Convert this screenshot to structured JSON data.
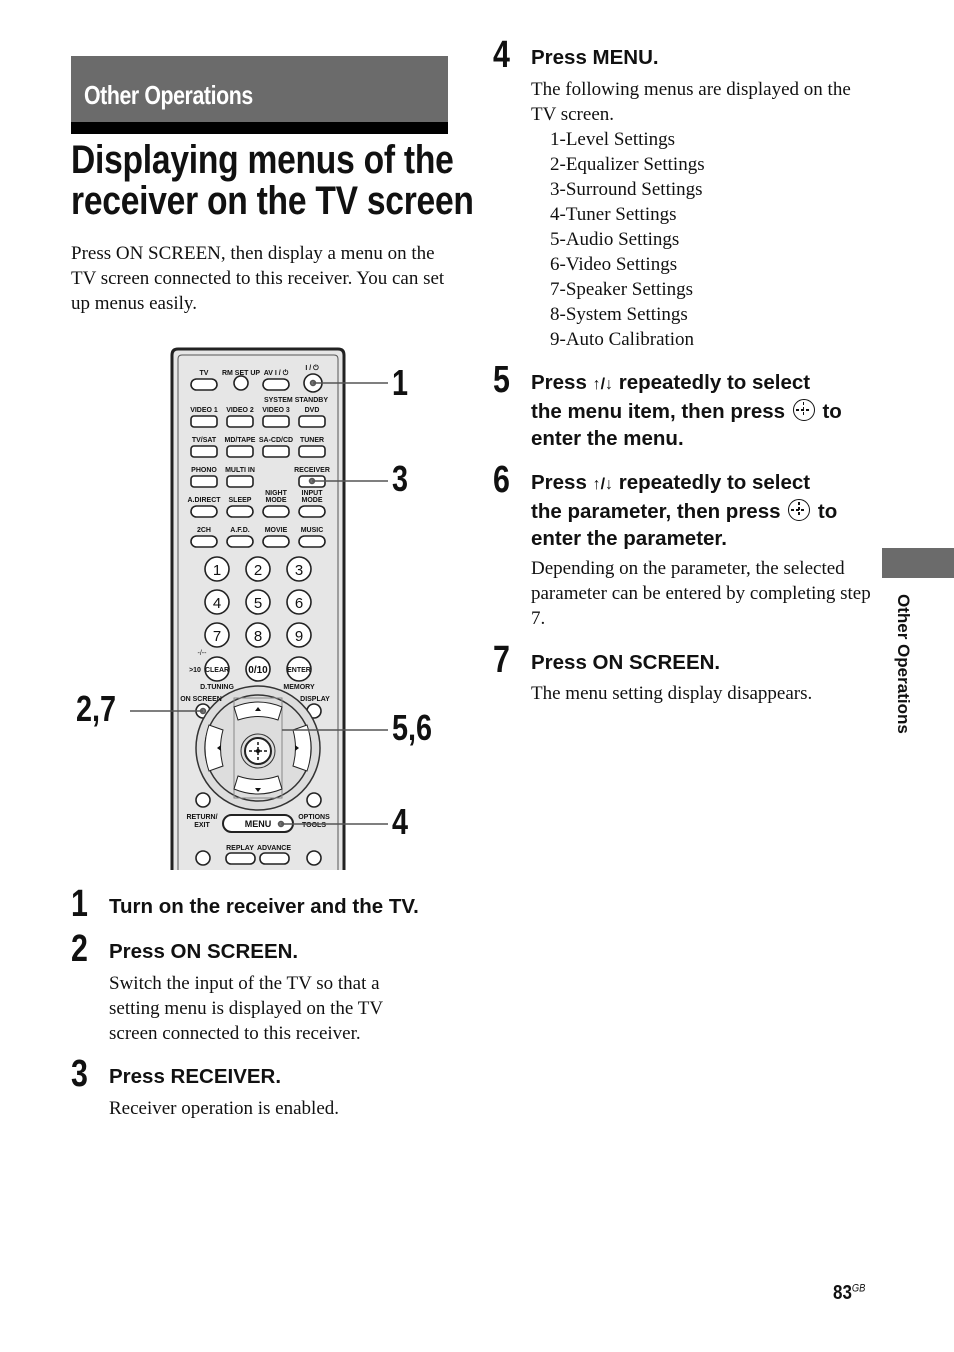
{
  "section": {
    "label": "Other Operations"
  },
  "title": {
    "line1": "Displaying menus of the",
    "line2": "receiver on the TV screen"
  },
  "intro": "Press ON SCREEN, then display a menu on the TV screen connected to this receiver. You can set up menus easily.",
  "steps": [
    {
      "num": "1",
      "heading": "Turn on the receiver and the TV.",
      "body": ""
    },
    {
      "num": "2",
      "heading": "Press ON SCREEN.",
      "body": "Switch the input of the TV so that a setting menu is displayed on the TV screen connected to this receiver."
    },
    {
      "num": "3",
      "heading": "Press RECEIVER.",
      "body": "Receiver operation is enabled."
    },
    {
      "num": "4",
      "heading": "Press MENU.",
      "body": "The following menus are displayed on the TV screen.",
      "menus": [
        "1-Level Settings",
        "2-Equalizer Settings",
        "3-Surround Settings",
        "4-Tuner Settings",
        "5-Audio Settings",
        "6-Video Settings",
        "7-Speaker Settings",
        "8-System Settings",
        "9-Auto Calibration"
      ]
    },
    {
      "num": "5",
      "heading_a": "Press",
      "arrows": "↑/↓",
      "heading_b": "repeatedly to select",
      "heading_c": "the menu item, then press",
      "heading_d": "to",
      "heading_e": "enter the menu."
    },
    {
      "num": "6",
      "heading_a": "Press",
      "arrows": "↑/↓",
      "heading_b": "repeatedly to select",
      "heading_c": "the parameter, then press",
      "heading_d": "to",
      "heading_e": "enter the parameter.",
      "body": "Depending on the parameter, the selected parameter can be entered by completing step 7."
    },
    {
      "num": "7",
      "heading": "Press ON SCREEN.",
      "body": "The menu setting display disappears."
    }
  ],
  "remote": {
    "callouts": {
      "c1": "1",
      "c3": "3",
      "c27": "2,7",
      "c56": "5,6",
      "c4": "4"
    },
    "labels": {
      "tv": "TV",
      "rm_setup": "RM SET UP",
      "av": "AV I / ⏻",
      "power": "I / ⏻",
      "system_standby": "SYSTEM STANDBY",
      "video1": "VIDEO 1",
      "video2": "VIDEO 2",
      "video3": "VIDEO 3",
      "dvd": "DVD",
      "tvsat": "TV/SAT",
      "mdtape": "MD/TAPE",
      "sacd": "SA-CD/CD",
      "tuner": "TUNER",
      "phono": "PHONO",
      "multiin": "MULTI IN",
      "receiver": "RECEIVER",
      "adirect": "A.DIRECT",
      "sleep": "SLEEP",
      "night": "NIGHT",
      "mode": "MODE",
      "input": "INPUT",
      "ch2": "2CH",
      "afd": "A.F.D.",
      "movie": "MOVIE",
      "music": "MUSIC",
      "n1": "1",
      "n2": "2",
      "n3": "3",
      "n4": "4",
      "n5": "5",
      "n6": "6",
      "n7": "7",
      "n8": "8",
      "n9": "9",
      "gt10": ">10",
      "dashes": "-/--",
      "clear": "CLEAR",
      "n010": "0/10",
      "enter": "ENTER",
      "dtuning": "D.TUNING",
      "memory": "MEMORY",
      "onscreen": "ON SCREEN",
      "display": "DISPLAY",
      "return": "RETURN/",
      "exit": "EXIT",
      "menu": "MENU",
      "options": "OPTIONS",
      "tools": "TOOLS",
      "replay": "REPLAY",
      "advance": "ADVANCE"
    }
  },
  "sidebar": {
    "label": "Other Operations"
  },
  "footer": {
    "page": "83",
    "suffix": "GB"
  }
}
